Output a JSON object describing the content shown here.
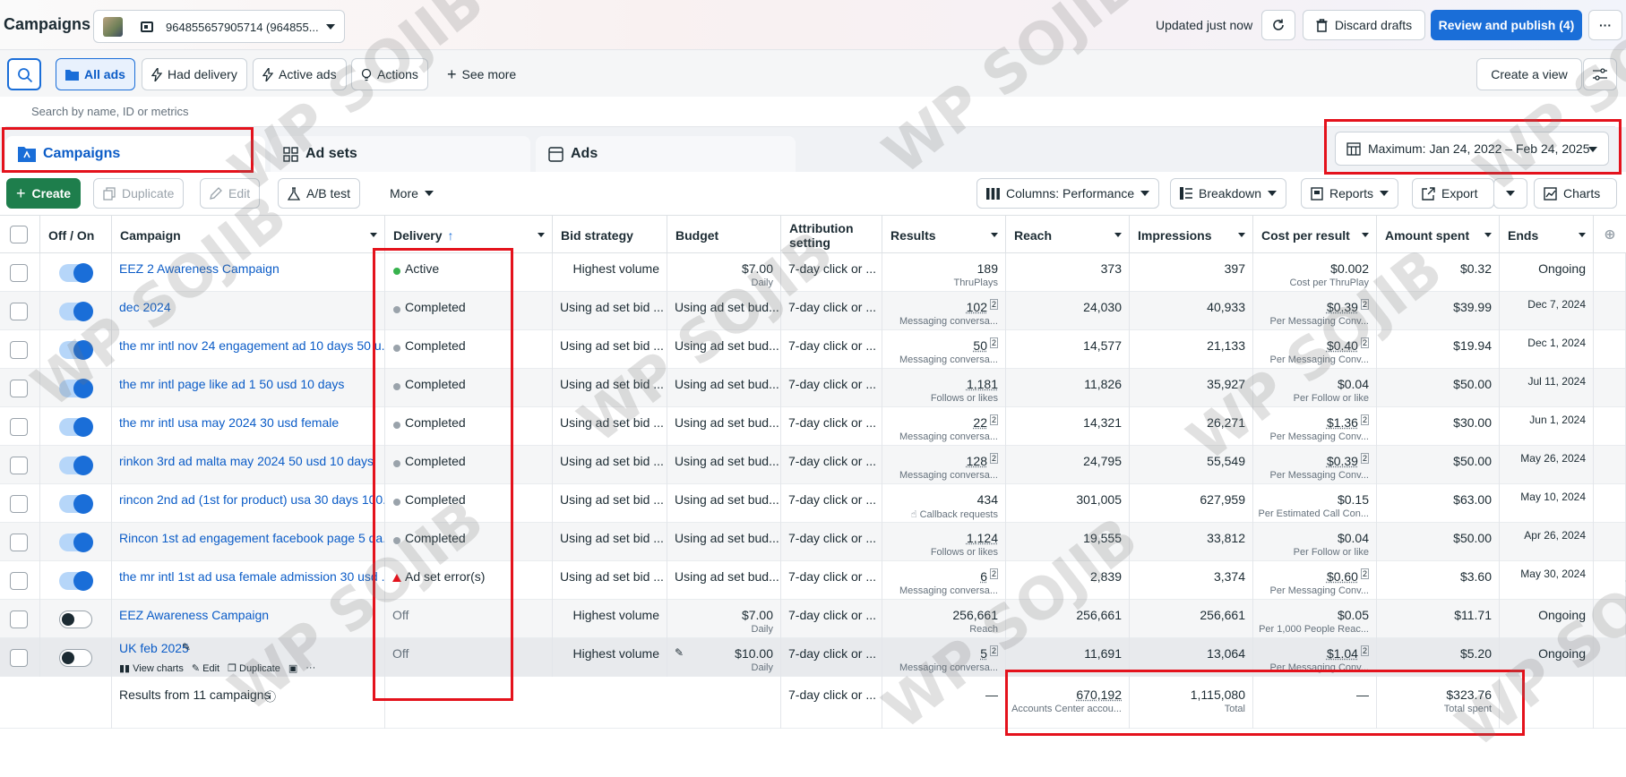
{
  "header": {
    "title": "Campaigns",
    "account_label": "964855657905714 (964855...",
    "updated_text": "Updated just now",
    "discard_label": "Discard drafts",
    "review_label": "Review and publish (4)"
  },
  "filters": {
    "all_ads": "All ads",
    "had_delivery": "Had delivery",
    "active_ads": "Active ads",
    "actions": "Actions",
    "see_more": "See more",
    "create_view": "Create a view"
  },
  "search": {
    "placeholder": "Search by name, ID or metrics"
  },
  "tabs": {
    "campaigns": "Campaigns",
    "ad_sets": "Ad sets",
    "ads": "Ads"
  },
  "date_range": "Maximum: Jan 24, 2022 – Feb 24, 2025",
  "toolbar": {
    "create": "Create",
    "duplicate": "Duplicate",
    "edit": "Edit",
    "ab_test": "A/B test",
    "more": "More",
    "columns": "Columns: Performance",
    "breakdown": "Breakdown",
    "reports": "Reports",
    "export": "Export",
    "charts": "Charts"
  },
  "columns": {
    "off_on": "Off / On",
    "campaign": "Campaign",
    "delivery": "Delivery",
    "bid_strategy": "Bid strategy",
    "budget": "Budget",
    "attribution": "Attribution setting",
    "results": "Results",
    "reach": "Reach",
    "impressions": "Impressions",
    "cost_per_result": "Cost per result",
    "amount_spent": "Amount spent",
    "ends": "Ends"
  },
  "rows": [
    {
      "campaign": "EEZ 2 Awareness Campaign",
      "delivery": "Active",
      "bid": "Highest volume",
      "budget": "$7.00",
      "budget_sub": "Daily",
      "attribution": "7-day click or ...",
      "results": "189",
      "results_sub": "ThruPlays",
      "reach": "373",
      "impressions": "397",
      "cpr": "$0.002",
      "cpr_sub": "Cost per ThruPlay",
      "spent": "$0.32",
      "ends": "Ongoing"
    },
    {
      "campaign": "dec 2024",
      "delivery": "Completed",
      "bid": "Using ad set bid ...",
      "budget": "Using ad set bud...",
      "budget_sub": "",
      "attribution": "7-day click or ...",
      "results": "102",
      "results_sub": "Messaging conversa...",
      "reach": "24,030",
      "impressions": "40,933",
      "cpr": "$0.39",
      "cpr_sub": "Per Messaging Conv...",
      "spent": "$39.99",
      "ends": "Dec 7, 2024"
    },
    {
      "campaign": "the mr intl nov 24 engagement ad 10 days 50 u...",
      "delivery": "Completed",
      "bid": "Using ad set bid ...",
      "budget": "Using ad set bud...",
      "budget_sub": "",
      "attribution": "7-day click or ...",
      "results": "50",
      "results_sub": "Messaging conversa...",
      "reach": "14,577",
      "impressions": "21,133",
      "cpr": "$0.40",
      "cpr_sub": "Per Messaging Conv...",
      "spent": "$19.94",
      "ends": "Dec 1, 2024"
    },
    {
      "campaign": "the mr intl page like ad 1 50 usd 10 days",
      "delivery": "Completed",
      "bid": "Using ad set bid ...",
      "budget": "Using ad set bud...",
      "budget_sub": "",
      "attribution": "7-day click or ...",
      "results": "1,181",
      "results_sub": "Follows or likes",
      "reach": "11,826",
      "impressions": "35,927",
      "cpr": "$0.04",
      "cpr_sub": "Per Follow or like",
      "spent": "$50.00",
      "ends": "Jul 11, 2024"
    },
    {
      "campaign": "the mr intl usa may 2024 30 usd female",
      "delivery": "Completed",
      "bid": "Using ad set bid ...",
      "budget": "Using ad set bud...",
      "budget_sub": "",
      "attribution": "7-day click or ...",
      "results": "22",
      "results_sub": "Messaging conversa...",
      "reach": "14,321",
      "impressions": "26,271",
      "cpr": "$1.36",
      "cpr_sub": "Per Messaging Conv...",
      "spent": "$30.00",
      "ends": "Jun 1, 2024"
    },
    {
      "campaign": "rinkon 3rd ad malta may 2024 50 usd 10 days",
      "delivery": "Completed",
      "bid": "Using ad set bid ...",
      "budget": "Using ad set bud...",
      "budget_sub": "",
      "attribution": "7-day click or ...",
      "results": "128",
      "results_sub": "Messaging conversa...",
      "reach": "24,795",
      "impressions": "55,549",
      "cpr": "$0.39",
      "cpr_sub": "Per Messaging Conv...",
      "spent": "$50.00",
      "ends": "May 26, 2024"
    },
    {
      "campaign": "rincon 2nd ad (1st for product) usa 30 days 100...",
      "delivery": "Completed",
      "bid": "Using ad set bid ...",
      "budget": "Using ad set bud...",
      "budget_sub": "",
      "attribution": "7-day click or ...",
      "results": "434",
      "results_sub": "Callback requests",
      "reach": "301,005",
      "impressions": "627,959",
      "cpr": "$0.15",
      "cpr_sub": "Per Estimated Call Con...",
      "spent": "$63.00",
      "ends": "May 10, 2024"
    },
    {
      "campaign": "Rincon 1st ad engagement facebook page 5 da...",
      "delivery": "Completed",
      "bid": "Using ad set bid ...",
      "budget": "Using ad set bud...",
      "budget_sub": "",
      "attribution": "7-day click or ...",
      "results": "1,124",
      "results_sub": "Follows or likes",
      "reach": "19,555",
      "impressions": "33,812",
      "cpr": "$0.04",
      "cpr_sub": "Per Follow or like",
      "spent": "$50.00",
      "ends": "Apr 26, 2024"
    },
    {
      "campaign": "the mr intl 1st ad usa female admission 30 usd ...",
      "delivery": "Ad set error(s)",
      "bid": "Using ad set bid ...",
      "budget": "Using ad set bud...",
      "budget_sub": "",
      "attribution": "7-day click or ...",
      "results": "6",
      "results_sub": "Messaging conversa...",
      "reach": "2,839",
      "impressions": "3,374",
      "cpr": "$0.60",
      "cpr_sub": "Per Messaging Conv...",
      "spent": "$3.60",
      "ends": "May 30, 2024"
    },
    {
      "campaign": "EEZ Awareness Campaign",
      "delivery": "Off",
      "bid": "Highest volume",
      "budget": "$7.00",
      "budget_sub": "Daily",
      "attribution": "7-day click or ...",
      "results": "256,661",
      "results_sub": "Reach",
      "reach": "256,661",
      "impressions": "256,661",
      "cpr": "$0.05",
      "cpr_sub": "Per 1,000 People Reac...",
      "spent": "$11.71",
      "ends": "Ongoing"
    },
    {
      "campaign": "UK feb 2025",
      "delivery": "Off",
      "bid": "Highest volume",
      "budget": "$10.00",
      "budget_sub": "Daily",
      "attribution": "7-day click or ...",
      "results": "5",
      "results_sub": "Messaging conversa...",
      "reach": "11,691",
      "impressions": "13,064",
      "cpr": "$1.04",
      "cpr_sub": "Per Messaging Conv...",
      "spent": "$5.20",
      "ends": "Ongoing"
    }
  ],
  "row_actions": {
    "view_charts": "View charts",
    "edit": "Edit",
    "duplicate": "Duplicate"
  },
  "summary": {
    "label": "Results from 11 campaigns",
    "attribution": "7-day click or ...",
    "results": "—",
    "reach": "670,192",
    "reach_sub": "Accounts Center accou...",
    "impressions": "1,115,080",
    "impressions_sub": "Total",
    "cpr": "—",
    "spent": "$323.76",
    "spent_sub": "Total spent"
  },
  "superscript": "2",
  "watermark": "WP SOJIB",
  "colors": {
    "primary": "#1a6ed8",
    "create_green": "#1e7e4c",
    "highlight_red": "#e4121c",
    "active_dot": "#37b24d"
  }
}
